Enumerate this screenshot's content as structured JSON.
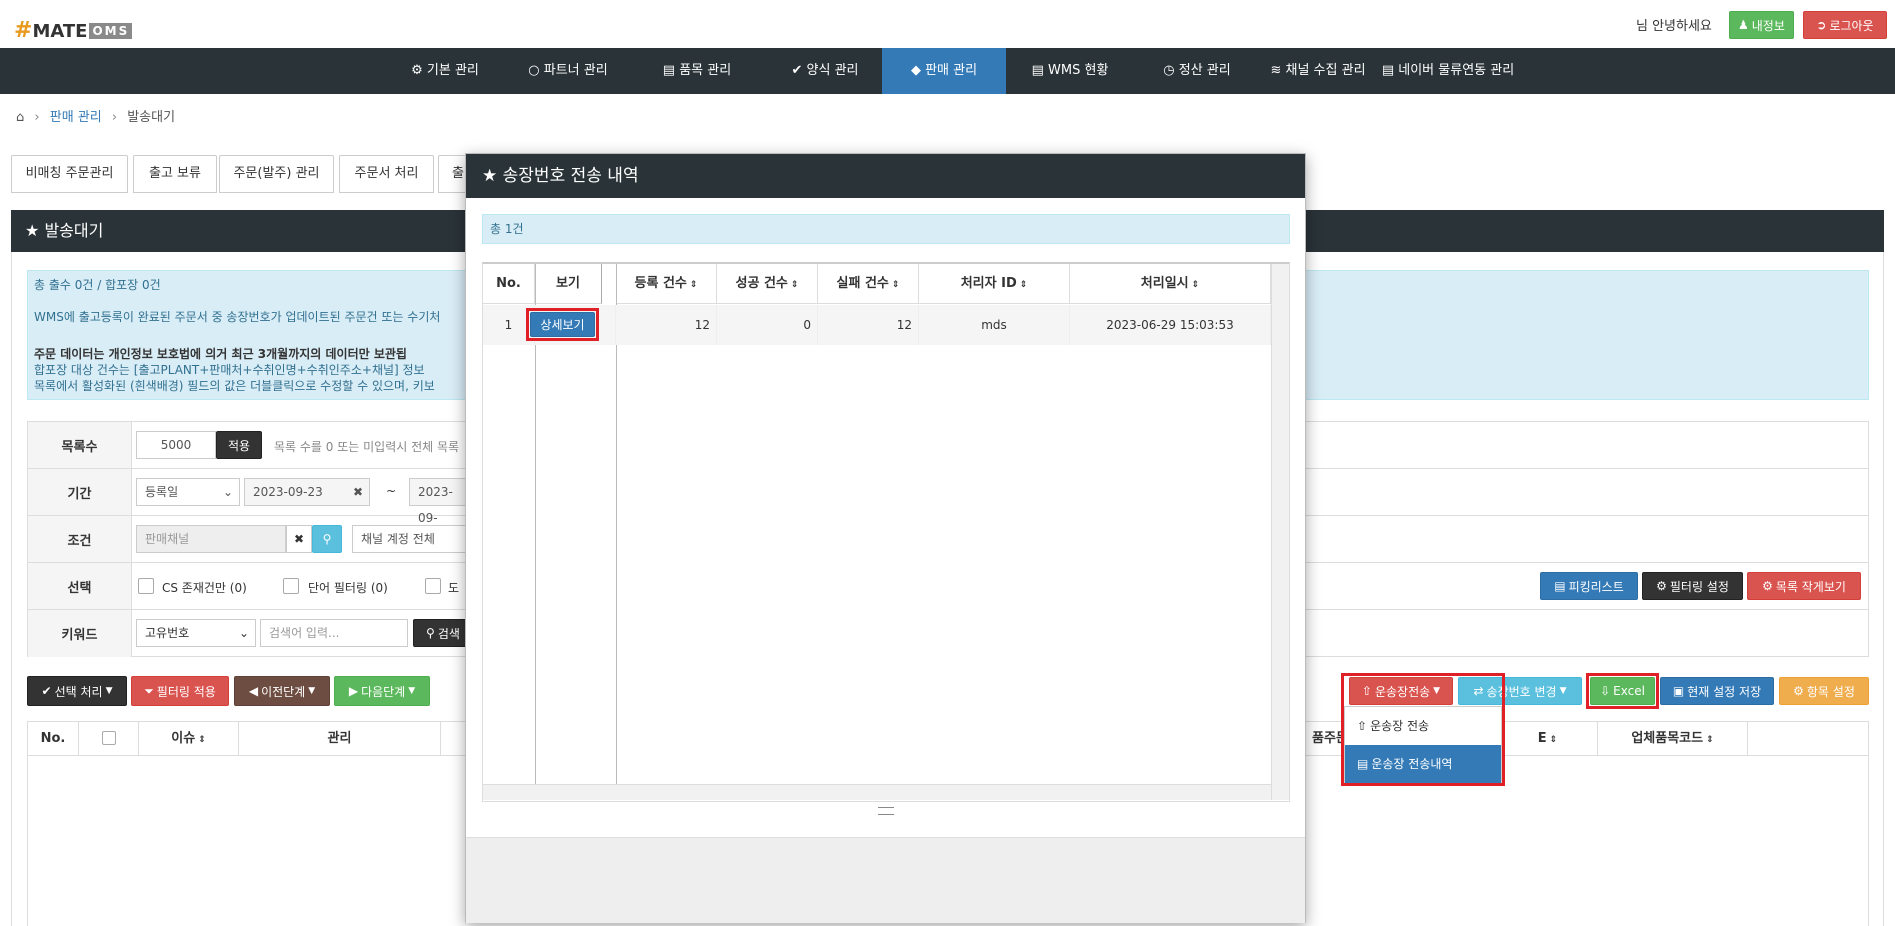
{
  "app": {
    "logo_main": "MATE",
    "logo_sub": "OMS",
    "greeting": "님 안녕하세요",
    "myinfo_label": "내정보",
    "logout_label": "로그아웃"
  },
  "nav": {
    "items": [
      {
        "label": "기본 관리",
        "icon": "gear-icon"
      },
      {
        "label": "파트너 관리",
        "icon": "lock-icon"
      },
      {
        "label": "품목 관리",
        "icon": "list-icon"
      },
      {
        "label": "양식 관리",
        "icon": "check-icon"
      },
      {
        "label": "판매 관리",
        "icon": "diamond-icon",
        "active": true
      },
      {
        "label": "WMS 현황",
        "icon": "card-icon"
      },
      {
        "label": "정산 관리",
        "icon": "clock-icon"
      },
      {
        "label": "채널 수집 관리",
        "icon": "rss-icon"
      },
      {
        "label": "네이버 물류연동 관리",
        "icon": "list-icon"
      }
    ]
  },
  "breadcrumb": {
    "home_icon": "home-icon",
    "section": "판매 관리",
    "current": "발송대기"
  },
  "tabs": [
    "비매칭 주문관리",
    "출고 보류",
    "주문(발주) 관리",
    "주문서 처리",
    "출"
  ],
  "panel": {
    "title": "발송대기"
  },
  "info": {
    "line1": "총 출수 0건 / 합포장 0건",
    "line2": "WMS에 출고등록이 완료된 주문서 중 송장번호가 업데이트된 주문건 또는 수기처",
    "line3": "주문 데이터는 개인정보 보호법에 의거 최근 3개월까지의 데이터만 보관됩",
    "line4": "합포장 대상 건수는 [출고PLANT+판매처+수취인명+수취인주소+채널] 정보",
    "line5": "목록에서 활성화된 (흰색배경) 필드의 값은 더블클릭으로 수정할 수 있으며, 키보"
  },
  "filter": {
    "rows_label": "목록수",
    "rows_value": "5000",
    "apply_label": "적용",
    "rows_hint": "목록 수를 0 또는 미입력시 전체 목록",
    "period_label": "기간",
    "period_type": "등록일",
    "date_from": "2023-09-23",
    "date_sep": "~",
    "date_to": "2023-09-",
    "cond_label": "조건",
    "channel_placeholder": "판매채널",
    "account_select": "채널 계정 전체",
    "select_label": "선택",
    "cs_only": "CS 존재건만 (0)",
    "word_filter": "단어 필터링 (0)",
    "extra_check": "도",
    "keyword_label": "키워드",
    "keyword_type": "고유번호",
    "keyword_placeholder": "검색어 입력...",
    "search_label": "검색",
    "picking_label": "피킹리스트",
    "filter_setting_label": "필터링 설정",
    "list_small_label": "목록 작게보기"
  },
  "toolbar": {
    "select_process": "선택 처리",
    "filter_apply": "필터링 적용",
    "prev_step": "이전단계",
    "next_step": "다음단계",
    "waybill_send": "운송장전송",
    "waybill_change": "송장번호 변경",
    "excel": "Excel",
    "save_current": "현재 설정 저장",
    "column_setting": "항목 설정"
  },
  "dropdown": {
    "items": [
      "운송장 전송",
      "운송장 전송내역"
    ]
  },
  "grid": {
    "headers": [
      "No.",
      "",
      "이슈",
      "관리",
      "품주문",
      "E",
      "업체품목코드"
    ]
  },
  "modal": {
    "title": "송장번호 전송 내역",
    "total": "총 1건",
    "headers": [
      "No.",
      "보기",
      "등록 건수",
      "성공 건수",
      "실패 건수",
      "처리자 ID",
      "처리일시"
    ],
    "rows": [
      {
        "no": "1",
        "view": "상세보기",
        "registered": "12",
        "success": "0",
        "failed": "12",
        "user": "mds",
        "datetime": "2023-06-29 15:03:53"
      }
    ]
  }
}
